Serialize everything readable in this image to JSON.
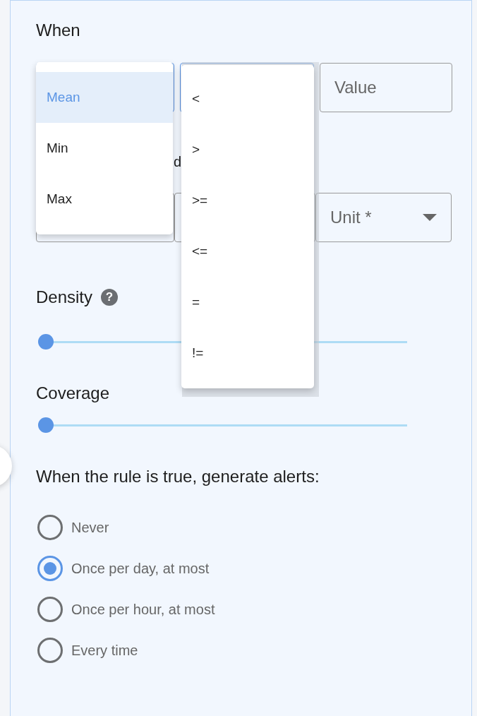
{
  "heading": "When",
  "value_field": {
    "placeholder": "Value"
  },
  "row_label": "d",
  "unit_select": {
    "label": "Unit *"
  },
  "statistic_menu": [
    {
      "label": "Mean",
      "selected": true
    },
    {
      "label": "Min",
      "selected": false
    },
    {
      "label": "Max",
      "selected": false
    }
  ],
  "condition_menu": [
    {
      "label": "<",
      "selected": false
    },
    {
      "label": ">",
      "selected": false
    },
    {
      "label": ">=",
      "selected": false
    },
    {
      "label": "<=",
      "selected": false
    },
    {
      "label": "=",
      "selected": false
    },
    {
      "label": "!=",
      "selected": false
    }
  ],
  "sliders": [
    {
      "label": "Density",
      "help": "?",
      "level": 0
    },
    {
      "label": "Coverage",
      "level": 0
    }
  ],
  "alerts": {
    "title": "When the rule is true, generate alerts:",
    "options": [
      {
        "label": "Never",
        "selected": false
      },
      {
        "label": "Once per day, at most",
        "selected": true
      },
      {
        "label": "Once per hour, at most",
        "selected": false
      },
      {
        "label": "Every time",
        "selected": false
      }
    ]
  }
}
